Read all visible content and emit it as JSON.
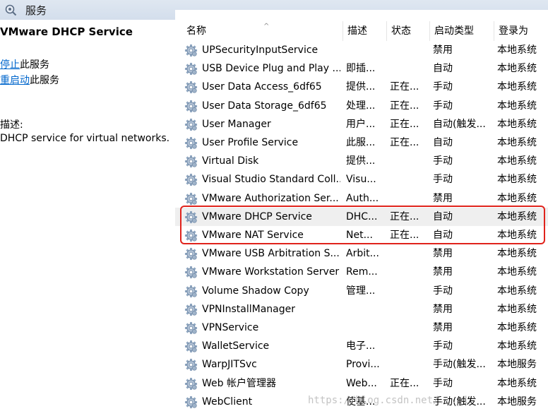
{
  "window": {
    "title": "服务"
  },
  "left_panel": {
    "service_title": "VMware DHCP Service",
    "stop_link": "停止",
    "stop_suffix": "此服务",
    "restart_link": "重启动",
    "restart_suffix": "此服务",
    "description_label": "描述:",
    "description_text": "DHCP service for virtual networks."
  },
  "columns": {
    "name": "名称",
    "description": "描述",
    "status": "状态",
    "startup_type": "启动类型",
    "logon_as": "登录为"
  },
  "services": [
    {
      "name": "UPSecurityInputService",
      "description": "",
      "status": "",
      "startup": "禁用",
      "logon": "本地系统"
    },
    {
      "name": "USB Device Plug and Play ...",
      "description": "即插...",
      "status": "",
      "startup": "自动",
      "logon": "本地系统"
    },
    {
      "name": "User Data Access_6df65",
      "description": "提供...",
      "status": "正在...",
      "startup": "手动",
      "logon": "本地系统"
    },
    {
      "name": "User Data Storage_6df65",
      "description": "处理...",
      "status": "正在...",
      "startup": "手动",
      "logon": "本地系统"
    },
    {
      "name": "User Manager",
      "description": "用户...",
      "status": "正在...",
      "startup": "自动(触发...",
      "logon": "本地系统"
    },
    {
      "name": "User Profile Service",
      "description": "此服...",
      "status": "正在...",
      "startup": "自动",
      "logon": "本地系统"
    },
    {
      "name": "Virtual Disk",
      "description": "提供...",
      "status": "",
      "startup": "手动",
      "logon": "本地系统"
    },
    {
      "name": "Visual Studio Standard Coll...",
      "description": "Visu...",
      "status": "",
      "startup": "手动",
      "logon": "本地系统"
    },
    {
      "name": "VMware Authorization Ser...",
      "description": "Auth...",
      "status": "",
      "startup": "禁用",
      "logon": "本地系统"
    },
    {
      "name": "VMware DHCP Service",
      "description": "DHC...",
      "status": "正在...",
      "startup": "自动",
      "logon": "本地系统"
    },
    {
      "name": "VMware NAT Service",
      "description": "Net...",
      "status": "正在...",
      "startup": "自动",
      "logon": "本地系统"
    },
    {
      "name": "VMware USB Arbitration S...",
      "description": "Arbit...",
      "status": "",
      "startup": "禁用",
      "logon": "本地系统"
    },
    {
      "name": "VMware Workstation Server",
      "description": "Rem...",
      "status": "",
      "startup": "禁用",
      "logon": "本地系统"
    },
    {
      "name": "Volume Shadow Copy",
      "description": "管理...",
      "status": "",
      "startup": "手动",
      "logon": "本地系统"
    },
    {
      "name": "VPNInstallManager",
      "description": "",
      "status": "",
      "startup": "禁用",
      "logon": "本地系统"
    },
    {
      "name": "VPNService",
      "description": "",
      "status": "",
      "startup": "禁用",
      "logon": "本地系统"
    },
    {
      "name": "WalletService",
      "description": "电子...",
      "status": "",
      "startup": "手动",
      "logon": "本地系统"
    },
    {
      "name": "WarpJITSvc",
      "description": "Provi...",
      "status": "",
      "startup": "手动(触发...",
      "logon": "本地服务"
    },
    {
      "name": "Web 帐户管理器",
      "description": "Web...",
      "status": "正在...",
      "startup": "手动",
      "logon": "本地系统"
    },
    {
      "name": "WebClient",
      "description": "使基...",
      "status": "",
      "startup": "手动(触发...",
      "logon": "本地服务"
    }
  ],
  "selected_service": "VMware DHCP Service",
  "watermark": "https://blog.csdn.net/..._1",
  "colors": {
    "highlight_box": "#e0231c",
    "link": "#0066cc",
    "selected_row": "#efefef"
  }
}
